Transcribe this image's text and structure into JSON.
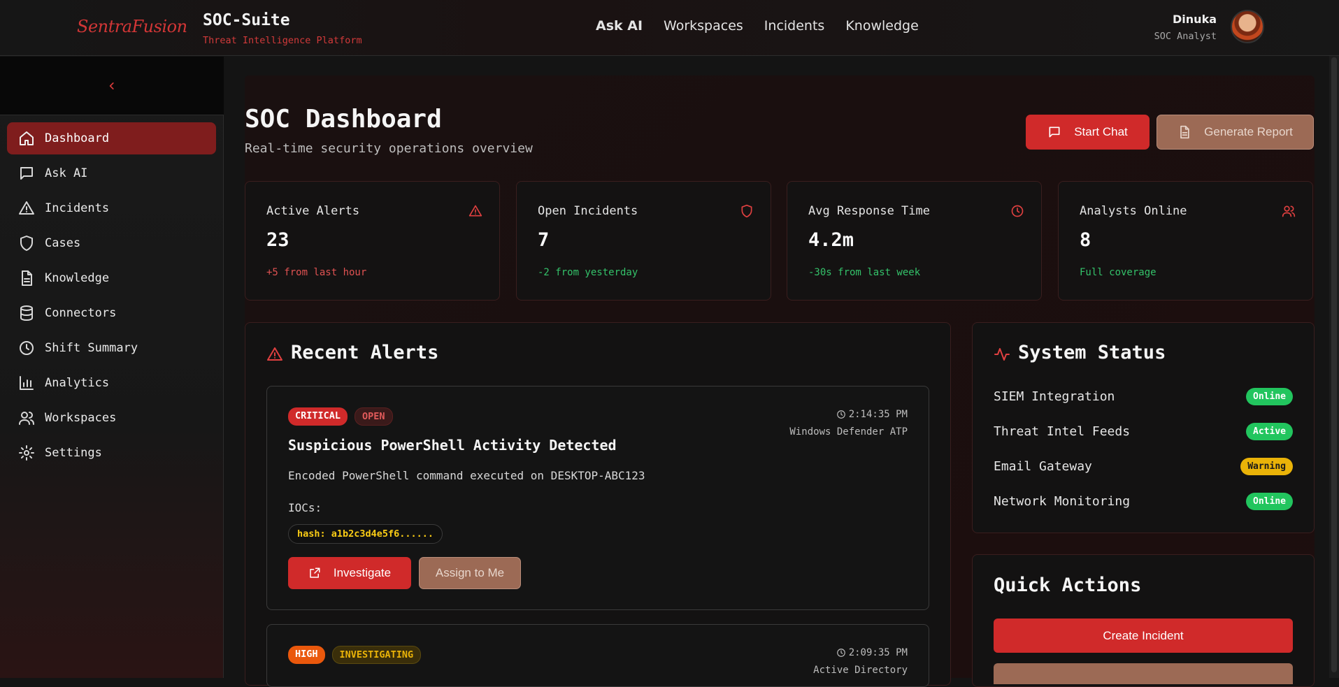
{
  "header": {
    "logo": "SentraFusion",
    "title": "SOC-Suite",
    "subtitle": "Threat Intelligence Platform",
    "nav": [
      "Ask AI",
      "Workspaces",
      "Incidents",
      "Knowledge"
    ],
    "user": {
      "name": "Dinuka",
      "role": "SOC Analyst"
    }
  },
  "sidebar": {
    "items": [
      {
        "label": "Dashboard",
        "icon": "home-icon",
        "active": true
      },
      {
        "label": "Ask AI",
        "icon": "message-icon"
      },
      {
        "label": "Incidents",
        "icon": "alert-triangle-icon"
      },
      {
        "label": "Cases",
        "icon": "shield-icon"
      },
      {
        "label": "Knowledge",
        "icon": "document-icon"
      },
      {
        "label": "Connectors",
        "icon": "database-icon"
      },
      {
        "label": "Shift Summary",
        "icon": "clock-icon"
      },
      {
        "label": "Analytics",
        "icon": "bar-chart-icon"
      },
      {
        "label": "Workspaces",
        "icon": "users-icon"
      },
      {
        "label": "Settings",
        "icon": "gear-icon"
      }
    ]
  },
  "page": {
    "title": "SOC Dashboard",
    "subtitle": "Real-time security operations overview",
    "start_chat": "Start Chat",
    "generate_report": "Generate Report"
  },
  "stats": [
    {
      "label": "Active Alerts",
      "value": "23",
      "change": "+5 from last hour",
      "tone": "red",
      "icon": "alert-triangle-icon"
    },
    {
      "label": "Open Incidents",
      "value": "7",
      "change": "-2 from yesterday",
      "tone": "green",
      "icon": "shield-icon"
    },
    {
      "label": "Avg Response Time",
      "value": "4.2m",
      "change": "-30s from last week",
      "tone": "green",
      "icon": "clock-icon"
    },
    {
      "label": "Analysts Online",
      "value": "8",
      "change": "Full coverage",
      "tone": "green",
      "icon": "users-icon"
    }
  ],
  "alerts": {
    "title": "Recent Alerts",
    "items": [
      {
        "severity": "CRITICAL",
        "status": "OPEN",
        "title": "Suspicious PowerShell Activity Detected",
        "description": "Encoded PowerShell command executed on DESKTOP-ABC123",
        "time": "2:14:35 PM",
        "source": "Windows Defender ATP",
        "iocs_label": "IOCs:",
        "iocs": [
          "hash: a1b2c3d4e5f6......"
        ],
        "investigate": "Investigate",
        "assign": "Assign to Me"
      },
      {
        "severity": "HIGH",
        "status": "INVESTIGATING",
        "time": "2:09:35 PM",
        "source": "Active Directory"
      }
    ]
  },
  "system_status": {
    "title": "System Status",
    "items": [
      {
        "name": "SIEM Integration",
        "status": "Online",
        "color": "#22c55e"
      },
      {
        "name": "Threat Intel Feeds",
        "status": "Active",
        "color": "#22c55e"
      },
      {
        "name": "Email Gateway",
        "status": "Warning",
        "color": "#eab308"
      },
      {
        "name": "Network Monitoring",
        "status": "Online",
        "color": "#22c55e"
      }
    ]
  },
  "quick_actions": {
    "title": "Quick Actions",
    "create_incident": "Create Incident"
  },
  "colors": {
    "accent": "#d02a2a",
    "active_nav": "#7f1d1d",
    "success": "#22c55e",
    "warning": "#eab308"
  }
}
